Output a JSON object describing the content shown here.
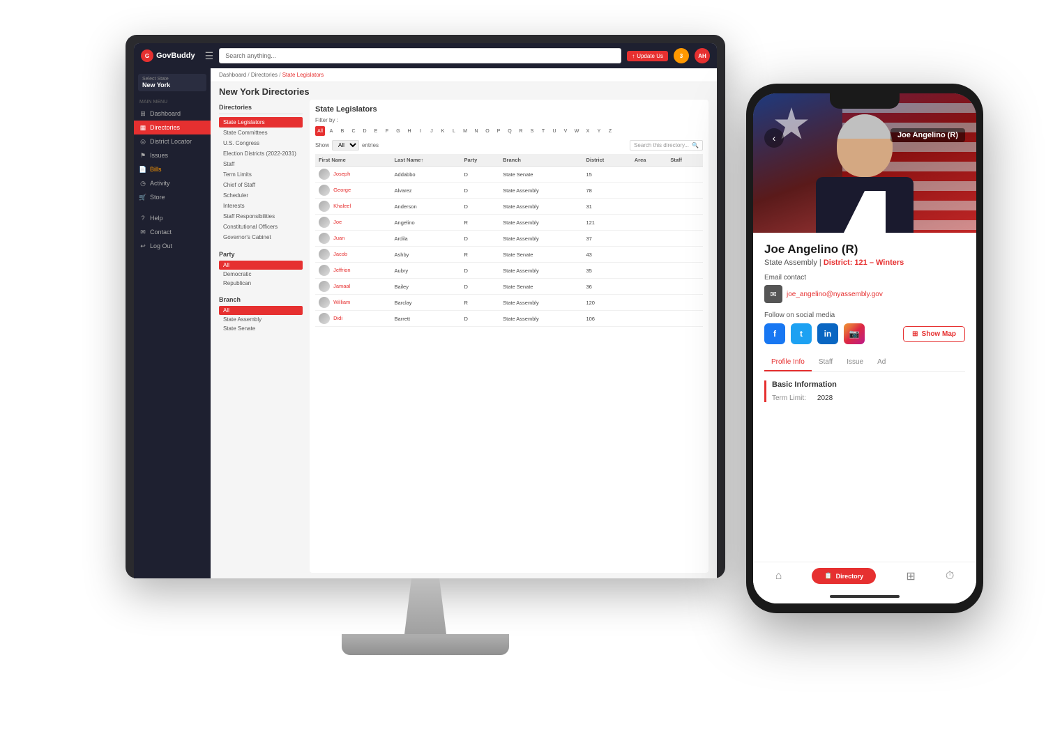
{
  "scene": {
    "bg": "#ffffff"
  },
  "app": {
    "logo_text": "GovBuddy",
    "search_placeholder": "Search anything...",
    "update_btn": "Update Us",
    "notification_count": "3",
    "avatar_initials": "AH"
  },
  "sidebar": {
    "state_selector_label": "Select State",
    "state_name": "New York",
    "menu_label": "Main Menu",
    "items": [
      {
        "id": "dashboard",
        "label": "Dashboard",
        "icon": "⊞"
      },
      {
        "id": "directories",
        "label": "Directories",
        "icon": "▦",
        "active": true
      },
      {
        "id": "district-locator",
        "label": "District Locator",
        "icon": "◎"
      },
      {
        "id": "issues",
        "label": "Issues",
        "icon": "⚑"
      },
      {
        "id": "bills",
        "label": "Bills",
        "icon": "📄",
        "warning": true
      },
      {
        "id": "activity",
        "label": "Activity",
        "icon": "◷"
      },
      {
        "id": "store",
        "label": "Store",
        "icon": "🛒"
      },
      {
        "id": "help",
        "label": "Help",
        "icon": "?"
      },
      {
        "id": "contact",
        "label": "Contact",
        "icon": "✉"
      },
      {
        "id": "logout",
        "label": "Log Out",
        "icon": "↩"
      }
    ]
  },
  "breadcrumb": {
    "items": [
      "Dashboard",
      "Directories",
      "State Legislators"
    ]
  },
  "page_title": "New York Directories",
  "directories": {
    "heading": "Directories",
    "items": [
      {
        "label": "State Legislators",
        "active": true
      },
      {
        "label": "State Committees"
      },
      {
        "label": "U.S. Congress"
      },
      {
        "label": "Election Districts (2022-2031)"
      },
      {
        "label": "Staff"
      },
      {
        "label": "Term Limits"
      },
      {
        "label": "Chief of Staff"
      },
      {
        "label": "Scheduler"
      },
      {
        "label": "Interests"
      },
      {
        "label": "Staff Responsibilities"
      },
      {
        "label": "Constitutional Officers"
      },
      {
        "label": "Governor's Cabinet"
      }
    ],
    "party_heading": "Party",
    "party_items": [
      {
        "label": "All",
        "active": true
      },
      {
        "label": "Democratic"
      },
      {
        "label": "Republican"
      }
    ],
    "branch_heading": "Branch",
    "branch_items": [
      {
        "label": "All",
        "active": true
      },
      {
        "label": "State Assembly"
      },
      {
        "label": "State Senate"
      }
    ]
  },
  "legislators": {
    "title": "State Legislators",
    "filter_label": "Filter by :",
    "alphabet": [
      "All",
      "A",
      "B",
      "C",
      "D",
      "E",
      "F",
      "G",
      "H",
      "I",
      "J",
      "K",
      "L",
      "M",
      "N",
      "O",
      "P",
      "Q",
      "R",
      "S",
      "T",
      "U",
      "V",
      "W",
      "X",
      "Y",
      "Z"
    ],
    "active_alpha": "All",
    "show_label": "Show",
    "entries_label": "entries",
    "search_placeholder": "Search this directory...",
    "columns": [
      "First Name",
      "Last Name↑",
      "Party",
      "Branch",
      "District",
      "Area",
      "Staff"
    ],
    "rows": [
      {
        "first": "Joseph",
        "last": "Addabbo",
        "party": "D",
        "branch": "State Senate",
        "district": "15"
      },
      {
        "first": "George",
        "last": "Alvarez",
        "party": "D",
        "branch": "State Assembly",
        "district": "78"
      },
      {
        "first": "Khaleel",
        "last": "Anderson",
        "party": "D",
        "branch": "State Assembly",
        "district": "31"
      },
      {
        "first": "Joe",
        "last": "Angelino",
        "party": "R",
        "branch": "State Assembly",
        "district": "121"
      },
      {
        "first": "Juan",
        "last": "Ardila",
        "party": "D",
        "branch": "State Assembly",
        "district": "37"
      },
      {
        "first": "Jacob",
        "last": "Ashby",
        "party": "R",
        "branch": "State Senate",
        "district": "43"
      },
      {
        "first": "Jeffrion",
        "last": "Aubry",
        "party": "D",
        "branch": "State Assembly",
        "district": "35"
      },
      {
        "first": "Jamaal",
        "last": "Bailey",
        "party": "D",
        "branch": "State Senate",
        "district": "36"
      },
      {
        "first": "William",
        "last": "Barclay",
        "party": "R",
        "branch": "State Assembly",
        "district": "120"
      },
      {
        "first": "Didi",
        "last": "Barrett",
        "party": "D",
        "branch": "State Assembly",
        "district": "106"
      }
    ]
  },
  "mobile_profile": {
    "name": "Joe Angelino (R)",
    "branch": "State Assembly",
    "district_label": "District: 121 – Winters",
    "email_contact_label": "Email contact",
    "email": "joe_angelino@nyassembly.gov",
    "social_label": "Follow on social media",
    "social_icons": [
      "f",
      "t",
      "in",
      "ig"
    ],
    "show_map_label": "Show Map",
    "tabs": [
      "Profile Info",
      "Staff",
      "Issue",
      "Ad"
    ],
    "active_tab": "Profile Info",
    "basic_info_title": "Basic Information",
    "term_limit_label": "Term Limit:",
    "term_limit_value": "2028",
    "bottom_nav": [
      {
        "icon": "⌂",
        "label": "home"
      },
      {
        "icon": "📋",
        "label": "Directory",
        "active": true
      },
      {
        "icon": "⊞",
        "label": "map"
      },
      {
        "icon": "⏱",
        "label": "time"
      }
    ]
  }
}
